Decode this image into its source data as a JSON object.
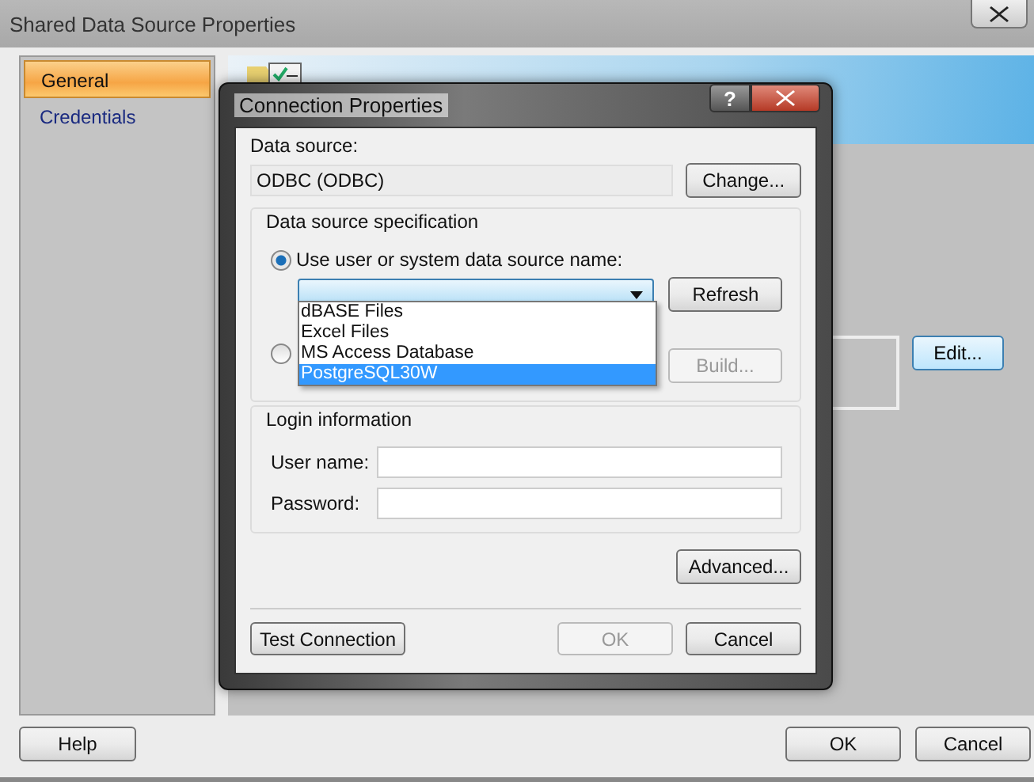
{
  "window": {
    "title": "Shared Data Source Properties"
  },
  "sidebar": {
    "items": [
      {
        "label": "General",
        "selected": true
      },
      {
        "label": "Credentials",
        "selected": false
      }
    ]
  },
  "content": {
    "edit_button": "Edit..."
  },
  "buttons": {
    "help": "Help",
    "ok": "OK",
    "cancel": "Cancel"
  },
  "dialog": {
    "title": "Connection Properties",
    "help_button": "?",
    "data_source_label": "Data source:",
    "data_source_value": "ODBC (ODBC)",
    "change_button": "Change...",
    "spec": {
      "title": "Data source specification",
      "options": [
        {
          "label": "Use user or system data source name:",
          "selected": true
        },
        {
          "selected": false
        }
      ],
      "dropdown": {
        "expanded": true,
        "items": [
          {
            "label": "dBASE Files",
            "selected": false
          },
          {
            "label": "Excel Files",
            "selected": false
          },
          {
            "label": "MS Access Database",
            "selected": false
          },
          {
            "label": "PostgreSQL30W",
            "selected": true
          }
        ]
      },
      "refresh_button": "Refresh",
      "build_button": {
        "label": "Build...",
        "disabled": true
      }
    },
    "login": {
      "title": "Login information",
      "fields": [
        {
          "label": "User name:"
        },
        {
          "label": "Password:"
        }
      ]
    },
    "advanced_button": "Advanced...",
    "test_button": "Test Connection",
    "ok_button": {
      "label": "OK",
      "disabled": true
    },
    "cancel_button": "Cancel"
  }
}
